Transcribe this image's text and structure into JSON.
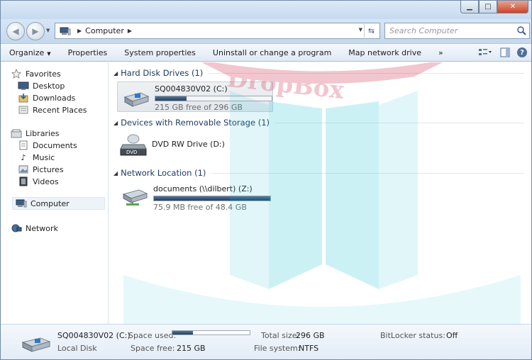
{
  "navigation": {
    "breadcrumb": [
      "Computer"
    ],
    "search_placeholder": "Search Computer"
  },
  "toolbar": {
    "organize_label": "Organize",
    "properties_label": "Properties",
    "system_properties_label": "System properties",
    "uninstall_label": "Uninstall or change a program",
    "map_drive_label": "Map network drive",
    "more_label": "»"
  },
  "sidebar": {
    "favorites": {
      "label": "Favorites",
      "items": [
        {
          "label": "Desktop",
          "icon": "desktop-icon"
        },
        {
          "label": "Downloads",
          "icon": "downloads-icon"
        },
        {
          "label": "Recent Places",
          "icon": "recent-places-icon"
        }
      ]
    },
    "libraries": {
      "label": "Libraries",
      "items": [
        {
          "label": "Documents",
          "icon": "documents-icon"
        },
        {
          "label": "Music",
          "icon": "music-icon"
        },
        {
          "label": "Pictures",
          "icon": "pictures-icon"
        },
        {
          "label": "Videos",
          "icon": "videos-icon"
        }
      ]
    },
    "computer_label": "Computer",
    "network_label": "Network"
  },
  "groups": {
    "hard_disk": {
      "header": "Hard Disk Drives (1)",
      "drives": [
        {
          "name": "SQ004830V02 (C:)",
          "free_text": "215 GB free of 296 GB",
          "used_fraction": 0.27
        }
      ]
    },
    "removable": {
      "header": "Devices with Removable Storage (1)",
      "drives": [
        {
          "name": "DVD RW Drive (D:)",
          "badge": "DVD"
        }
      ]
    },
    "network": {
      "header": "Network Location (1)",
      "drives": [
        {
          "name": "documents (\\\\dilbert) (Z:)",
          "free_text": "75.9 MB free of 48.4 GB",
          "used_fraction": 0.998
        }
      ]
    }
  },
  "details": {
    "name": "SQ004830V02 (C:)",
    "type": "Local Disk",
    "space_used_label": "Space used:",
    "space_used_fraction": 0.27,
    "space_free_label": "Space free:",
    "space_free_value": "215 GB",
    "total_size_label": "Total size:",
    "total_size_value": "296 GB",
    "file_system_label": "File system:",
    "file_system_value": "NTFS",
    "bitlocker_label": "BitLocker status:",
    "bitlocker_value": "Off"
  },
  "watermark_text": "DropBox",
  "colors": {
    "watermark_red": "#c8102e",
    "watermark_cyan": "#29c4d8",
    "accent_bar": "#1f3f63"
  }
}
